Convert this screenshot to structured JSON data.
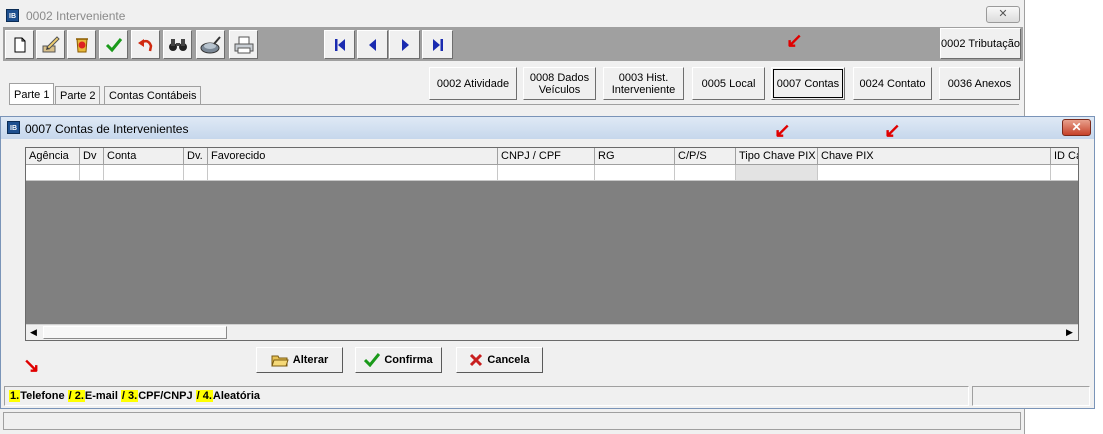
{
  "outer_window": {
    "icon_text": "IB",
    "title": "0002 Interveniente",
    "close_glyph": "✕"
  },
  "toolbar": {
    "icons": [
      "new-document-icon",
      "edit-pen-icon",
      "delete-icon",
      "confirm-check-icon",
      "undo-icon",
      "search-binoculars-icon",
      "tools-icon",
      "print-icon"
    ],
    "nav_icons": [
      "first-record-icon",
      "previous-record-icon",
      "next-record-icon",
      "last-record-icon"
    ],
    "tributacao_label": "0002 Tributação"
  },
  "tabs": [
    "Parte 1",
    "Parte 2",
    "Contas Contábeis"
  ],
  "active_tab": "Parte 1",
  "module_buttons": [
    "0002 Atividade",
    "0008 Dados Veículos",
    "0003 Hist. Interveniente",
    "0005 Local",
    "0007 Contas",
    "0024 Contato",
    "0036 Anexos"
  ],
  "dialog": {
    "icon_text": "IB",
    "title": "0007 Contas de Intervenientes",
    "close_glyph": "✕",
    "columns": [
      "Agência",
      "Dv",
      "Conta",
      "Dv.",
      "Favorecido",
      "CNPJ / CPF",
      "RG",
      "C/P/S",
      "Tipo Chave PIX",
      "Chave PIX",
      "ID Ca"
    ],
    "buttons": {
      "alterar": "Alterar",
      "confirma": "Confirma",
      "cancela": "Cancela"
    },
    "pix_hint": [
      {
        "num": "1.",
        "text": "Telefone"
      },
      {
        "num": "/ 2.",
        "text": "E-mail"
      },
      {
        "num": "/ 3.",
        "text": "CPF/CNPJ"
      },
      {
        "num": "/ 4.",
        "text": "Aleatória"
      }
    ]
  },
  "annotation_color": "#e00000",
  "highlight_color": "#ffff00"
}
